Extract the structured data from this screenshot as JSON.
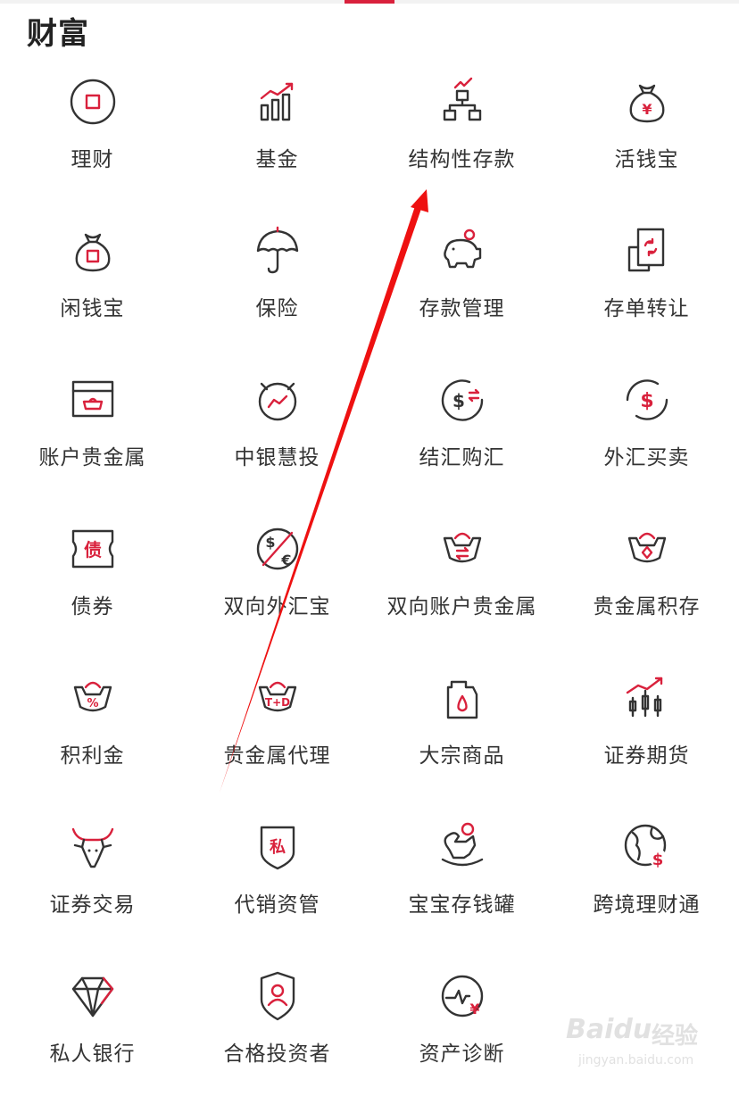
{
  "section": {
    "title": "财富"
  },
  "colors": {
    "accent": "#d9213c",
    "icon_stroke": "#333333",
    "text": "#333333"
  },
  "items": [
    {
      "label": "理财",
      "icon": "circle-square-icon"
    },
    {
      "label": "基金",
      "icon": "bar-trend-icon"
    },
    {
      "label": "结构性存款",
      "icon": "structure-icon"
    },
    {
      "label": "活钱宝",
      "icon": "money-bag-yen-icon"
    },
    {
      "label": "闲钱宝",
      "icon": "money-bag-square-icon"
    },
    {
      "label": "保险",
      "icon": "umbrella-icon"
    },
    {
      "label": "存款管理",
      "icon": "piggy-bank-icon"
    },
    {
      "label": "存单转让",
      "icon": "certificate-transfer-icon"
    },
    {
      "label": "账户贵金属",
      "icon": "gold-box-icon"
    },
    {
      "label": "中银慧投",
      "icon": "alarm-trend-icon"
    },
    {
      "label": "结汇购汇",
      "icon": "dollar-exchange-icon"
    },
    {
      "label": "外汇买卖",
      "icon": "dollar-cycle-icon"
    },
    {
      "label": "债券",
      "icon": "bond-ticket-icon"
    },
    {
      "label": "双向外汇宝",
      "icon": "dollar-euro-icon"
    },
    {
      "label": "双向账户贵金属",
      "icon": "gold-ingot-exchange-icon"
    },
    {
      "label": "贵金属积存",
      "icon": "gold-ingot-diamond-icon"
    },
    {
      "label": "积利金",
      "icon": "gold-ingot-percent-icon"
    },
    {
      "label": "贵金属代理",
      "icon": "gold-ingot-td-icon"
    },
    {
      "label": "大宗商品",
      "icon": "oil-can-icon"
    },
    {
      "label": "证券期货",
      "icon": "candlestick-icon"
    },
    {
      "label": "证券交易",
      "icon": "bull-icon"
    },
    {
      "label": "代销资管",
      "icon": "private-shield-icon"
    },
    {
      "label": "宝宝存钱罐",
      "icon": "rocking-horse-icon"
    },
    {
      "label": "跨境理财通",
      "icon": "globe-dollar-icon"
    },
    {
      "label": "私人银行",
      "icon": "diamond-icon"
    },
    {
      "label": "合格投资者",
      "icon": "person-shield-icon"
    },
    {
      "label": "资产诊断",
      "icon": "pulse-yen-icon"
    }
  ],
  "watermark": {
    "logo": "Baidu",
    "text": "经验",
    "url": "jingyan.baidu.com"
  }
}
